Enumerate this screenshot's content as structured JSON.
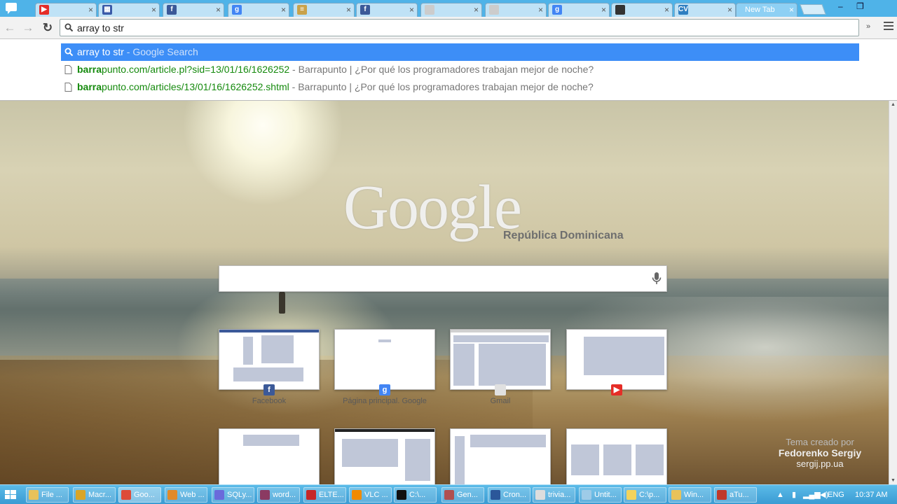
{
  "browser": {
    "tabs": [
      {
        "title": "",
        "icon": "youtube-icon",
        "color": "#e52d27"
      },
      {
        "title": "",
        "icon": "grid-icon",
        "color": "#3a5aa8"
      },
      {
        "title": "",
        "icon": "facebook-icon",
        "color": "#3b5998"
      },
      {
        "title": "",
        "icon": "google-icon",
        "color": "#4285f4"
      },
      {
        "title": "",
        "icon": "document-icon",
        "color": "#c9a24a"
      },
      {
        "title": "",
        "icon": "facebook-icon",
        "color": "#3b5998"
      },
      {
        "title": "",
        "icon": "page-icon",
        "color": "#cccccc"
      },
      {
        "title": "",
        "icon": "page-icon",
        "color": "#cccccc"
      },
      {
        "title": "",
        "icon": "google-icon",
        "color": "#4285f4"
      },
      {
        "title": "",
        "icon": "photo-icon",
        "color": "#333333"
      },
      {
        "title": "",
        "icon": "cv-icon",
        "color": "#2f7fc1"
      }
    ],
    "active_tab": "New Tab",
    "omnibox_value": "array to str"
  },
  "suggestions": [
    {
      "main": "array to str",
      "suffix": " - Google Search",
      "type": "search"
    },
    {
      "url_bold": "barra",
      "url_rest": "punto.com/article.pl?sid=13/01/16/1626252",
      "desc": " - Barrapunto | ¿Por qué los programadores trabajan mejor de noche?",
      "type": "page"
    },
    {
      "url_bold": "barra",
      "url_rest": "punto.com/articles/13/01/16/1626252.shtml",
      "desc": " - Barrapunto | ¿Por qué los programadores trabajan mejor de noche?",
      "type": "page"
    }
  ],
  "newtab": {
    "logo": "Google",
    "region": "República Dominicana",
    "search_placeholder": "",
    "tiles": [
      {
        "label": "Facebook",
        "icon": "facebook-icon",
        "color": "#3b5998",
        "fav": "f"
      },
      {
        "label": "Página principal. Google",
        "icon": "google-icon",
        "color": "#4285f4",
        "fav": "g"
      },
      {
        "label": "Gmail",
        "icon": "page-icon",
        "color": "#e0e0e0",
        "fav": ""
      },
      {
        "label": "",
        "icon": "youtube-icon",
        "color": "#e52d27",
        "fav": "▶"
      },
      {
        "label": "",
        "icon": "",
        "color": "",
        "fav": ""
      },
      {
        "label": "",
        "icon": "",
        "color": "",
        "fav": ""
      },
      {
        "label": "",
        "icon": "",
        "color": "",
        "fav": ""
      },
      {
        "label": "",
        "icon": "",
        "color": "",
        "fav": ""
      }
    ],
    "theme_credit": {
      "line1": "Tema creado por",
      "author": "Fedorenko Sergiy",
      "site": "sergij.pp.ua"
    }
  },
  "taskbar": {
    "items": [
      {
        "label": "File ...",
        "icon": "folder-icon",
        "color": "#e8c25a"
      },
      {
        "label": "Macr...",
        "icon": "macro-icon",
        "color": "#d9a528"
      },
      {
        "label": "Goo...",
        "icon": "chrome-icon",
        "color": "#dd4b39"
      },
      {
        "label": "Web ...",
        "icon": "gear-icon",
        "color": "#e08a2a"
      },
      {
        "label": "SQLy...",
        "icon": "dolphin-icon",
        "color": "#6a6adb"
      },
      {
        "label": "word...",
        "icon": "books-icon",
        "color": "#8b3a62"
      },
      {
        "label": "ELTE...",
        "icon": "filezilla-icon",
        "color": "#c62828"
      },
      {
        "label": "VLC ...",
        "icon": "vlc-icon",
        "color": "#f08a00"
      },
      {
        "label": "C:\\...",
        "icon": "console-icon",
        "color": "#111111"
      },
      {
        "label": "Gen...",
        "icon": "gen-icon",
        "color": "#b05050"
      },
      {
        "label": "Cron...",
        "icon": "word-icon",
        "color": "#2b579a"
      },
      {
        "label": "trivia...",
        "icon": "window-icon",
        "color": "#dddddd"
      },
      {
        "label": "Untit...",
        "icon": "notepad-icon",
        "color": "#9ecbe8"
      },
      {
        "label": "C:\\p...",
        "icon": "notes-icon",
        "color": "#f3d35c"
      },
      {
        "label": "Win...",
        "icon": "folder-icon",
        "color": "#e8c25a"
      },
      {
        "label": "aTu...",
        "icon": "atube-icon",
        "color": "#c0392b"
      }
    ],
    "language": "ENG",
    "clock": "10:37 AM"
  }
}
